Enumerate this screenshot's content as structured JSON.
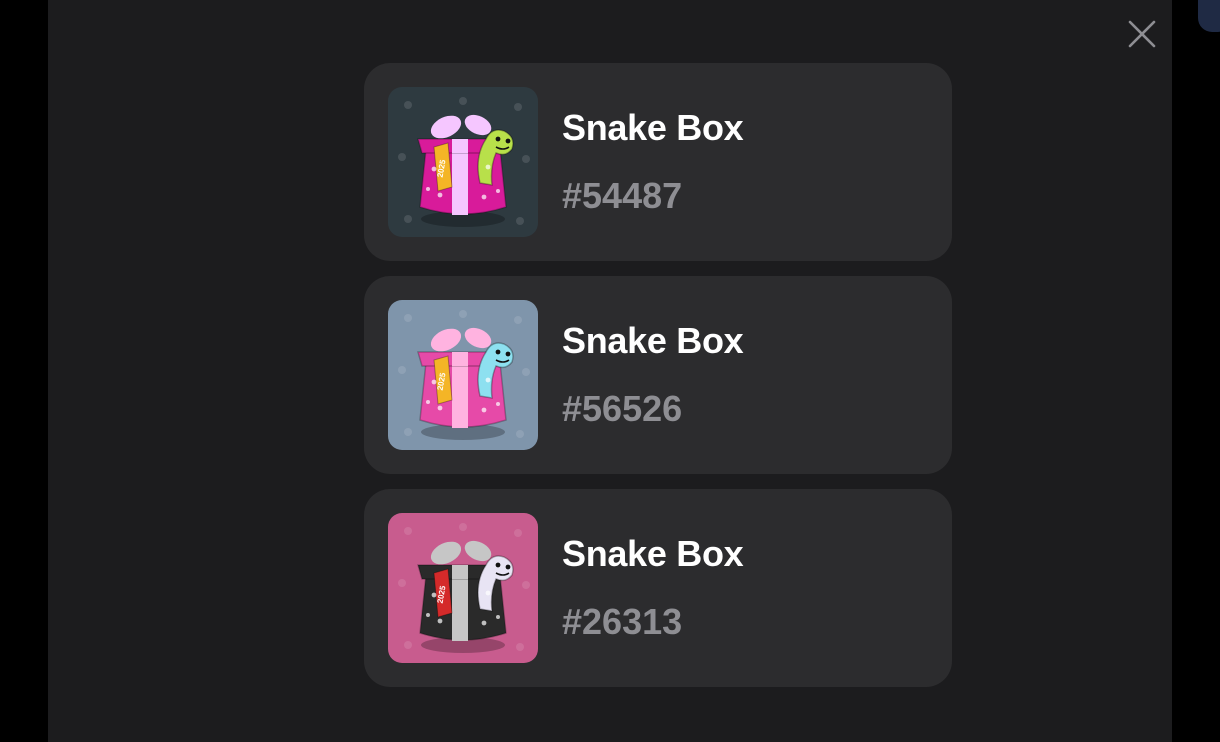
{
  "dialog": {
    "close_icon": "close-icon",
    "items": [
      {
        "title": "Snake Box",
        "number": "#54487",
        "bg": "#2e3a40",
        "box_color": "#d81b9a",
        "ribbon_color": "#f5c6ff",
        "snake_color": "#b8e04a",
        "tag_color": "#f4b526",
        "tag_text": "2025"
      },
      {
        "title": "Snake Box",
        "number": "#56526",
        "bg": "#7f95ab",
        "box_color": "#e64aa8",
        "ribbon_color": "#ffb3e0",
        "snake_color": "#8de0f0",
        "tag_color": "#f4b526",
        "tag_text": "2025"
      },
      {
        "title": "Snake Box",
        "number": "#26313",
        "bg": "#c85c8e",
        "box_color": "#2a2a2a",
        "ribbon_color": "#c6c6c6",
        "snake_color": "#e8e4f4",
        "tag_color": "#d42a2a",
        "tag_text": "2025"
      }
    ]
  }
}
